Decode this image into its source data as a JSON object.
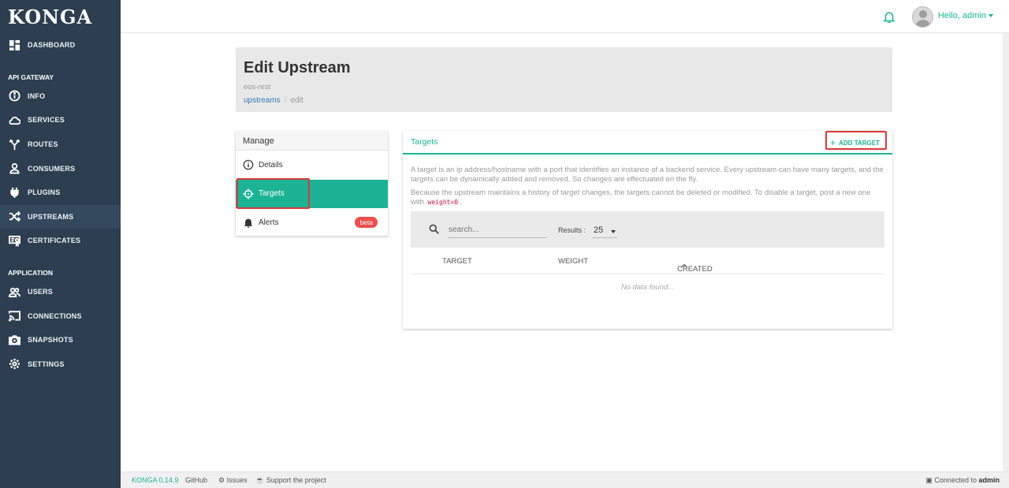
{
  "app": {
    "logo": "KONGA"
  },
  "sidebar": {
    "top_items": [
      {
        "label": "DASHBOARD",
        "icon": "dashboard-icon"
      }
    ],
    "sections": [
      {
        "title": "API GATEWAY",
        "items": [
          {
            "label": "INFO",
            "icon": "info-icon"
          },
          {
            "label": "SERVICES",
            "icon": "cloud-icon"
          },
          {
            "label": "ROUTES",
            "icon": "routes-icon"
          },
          {
            "label": "CONSUMERS",
            "icon": "user-icon"
          },
          {
            "label": "PLUGINS",
            "icon": "plug-icon"
          },
          {
            "label": "UPSTREAMS",
            "icon": "shuffle-icon",
            "active": true
          },
          {
            "label": "CERTIFICATES",
            "icon": "certificate-icon"
          }
        ]
      },
      {
        "title": "APPLICATION",
        "items": [
          {
            "label": "USERS",
            "icon": "users-icon"
          },
          {
            "label": "CONNECTIONS",
            "icon": "cast-icon"
          },
          {
            "label": "SNAPSHOTS",
            "icon": "camera-icon"
          },
          {
            "label": "SETTINGS",
            "icon": "gear-icon"
          }
        ]
      }
    ]
  },
  "topbar": {
    "greeting": "Hello, admin"
  },
  "header": {
    "title": "Edit Upstream",
    "subtitle": "eos-rest",
    "breadcrumb": {
      "link": "upstreams",
      "separator": "/",
      "current": "edit"
    }
  },
  "manage": {
    "title": "Manage",
    "items": [
      {
        "label": "Details",
        "icon": "info-icon"
      },
      {
        "label": "Targets",
        "icon": "crosshair-icon",
        "active": true
      },
      {
        "label": "Alerts",
        "icon": "bell-icon",
        "badge": "beta"
      }
    ]
  },
  "targets": {
    "title": "Targets",
    "add_button": "ADD TARGET",
    "description_1": "A target is an ip address/hostname with a port that identifies an instance of a backend service. Every upstream can have many targets, and the targets can be dynamically added and removed. So changes are effectuated on the fly.",
    "description_2_pre": "Because the upstream maintains a history of target changes, the targets cannot be deleted or modified. To disable a target, post a new one with",
    "description_2_code": "weight=0",
    "description_2_post": ".",
    "search_placeholder": "search...",
    "results_label": "Results :",
    "results_value": "25",
    "columns": [
      "TARGET",
      "WEIGHT",
      "CREATED"
    ],
    "empty_text": "No data found..."
  },
  "footer": {
    "version": "KONGA 0.14.9",
    "github": "GitHub",
    "issues": "Issues",
    "support": "Support the project",
    "connected_prefix": "Connected to",
    "connected_user": "admin"
  },
  "colors": {
    "sidebar": "#2c3e50",
    "accent": "#1bb394",
    "badge": "#ed4e4e",
    "highlight": "#d9383a"
  }
}
